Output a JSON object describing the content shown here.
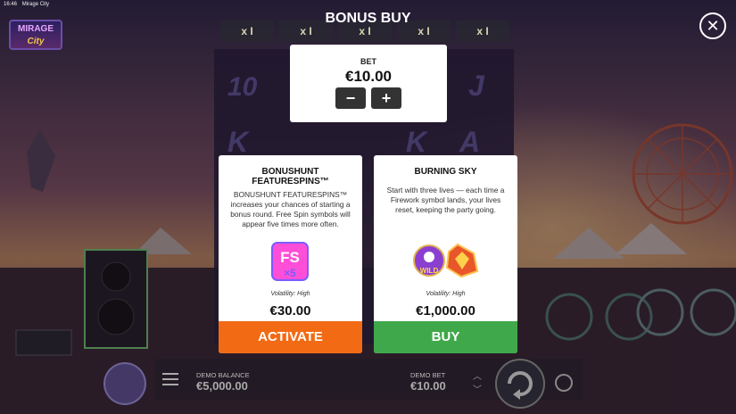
{
  "status_bar": {
    "time": "16:46",
    "page_title": "Mirage City"
  },
  "logo": {
    "line1": "MIRAGE",
    "line2": "City"
  },
  "reels_top": [
    "x I",
    "x I",
    "x I",
    "x I",
    "x I"
  ],
  "modal": {
    "title": "BONUS BUY",
    "bet": {
      "label": "BET",
      "value": "€10.00",
      "minus": "−",
      "plus": "+"
    },
    "cards": [
      {
        "title_line1": "BONUSHUNT",
        "title_line2": "FEATURESPINS™",
        "description": "BONUSHUNT FEATURESPINS™ increases your chances of starting a bonus round. Free Spin symbols will appear five times more often.",
        "volatility": "Volatility: High",
        "price": "€30.00",
        "action": "ACTIVATE",
        "action_color": "#f26a14"
      },
      {
        "title_line1": "BURNING SKY",
        "title_line2": "",
        "description": "Start with three lives — each time a Firework symbol lands, your lives reset, keeping the party going.",
        "volatility": "Volatility: High",
        "price": "€1,000.00",
        "action": "BUY",
        "action_color": "#3fa84a"
      }
    ]
  },
  "footer": {
    "demo_balance_label": "DEMO BALANCE",
    "demo_balance_value": "€5,000.00",
    "demo_bet_label": "DEMO BET",
    "demo_bet_value": "€10.00"
  }
}
